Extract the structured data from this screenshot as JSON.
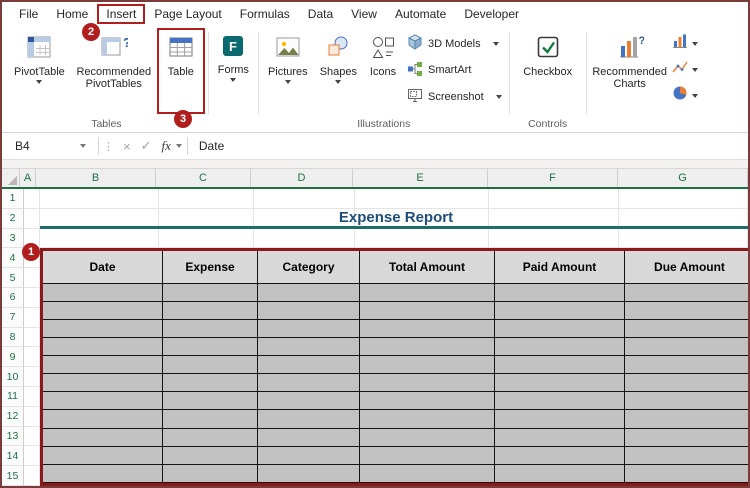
{
  "menu": {
    "tabs": [
      "File",
      "Home",
      "Insert",
      "Page Layout",
      "Formulas",
      "Data",
      "View",
      "Automate",
      "Developer"
    ],
    "active_tab": "Insert"
  },
  "ribbon": {
    "tables": {
      "label": "Tables",
      "pivottable": "PivotTable",
      "recommended_pivottables": "Recommended PivotTables",
      "table": "Table"
    },
    "forms": {
      "forms": "Forms"
    },
    "illustrations": {
      "label": "Illustrations",
      "pictures": "Pictures",
      "shapes": "Shapes",
      "icons": "Icons",
      "models_3d": "3D Models",
      "smartart": "SmartArt",
      "screenshot": "Screenshot"
    },
    "controls": {
      "label": "Controls",
      "checkbox": "Checkbox"
    },
    "charts": {
      "recommended_charts": "Recommended Charts"
    }
  },
  "formula_bar": {
    "name_box": "B4",
    "dots": "⋮",
    "cancel": "×",
    "enter": "✓",
    "fx": "fx",
    "formula": "Date"
  },
  "sheet": {
    "columns": [
      "A",
      "B",
      "C",
      "D",
      "E",
      "F",
      "G"
    ],
    "rows": [
      "1",
      "2",
      "3",
      "4",
      "5",
      "6",
      "7",
      "8",
      "9",
      "10",
      "11",
      "12",
      "13",
      "14",
      "15"
    ],
    "title": "Expense Report",
    "table": {
      "headers": [
        "Date",
        "Expense",
        "Category",
        "Total Amount",
        "Paid Amount",
        "Due Amount"
      ],
      "empty_rows": 11
    }
  },
  "annotations": {
    "steps": [
      "1",
      "2",
      "3"
    ]
  },
  "colors": {
    "annotation_red": "#b01e1e",
    "table_border_red": "#8a1a1a",
    "title_blue": "#1f4e79",
    "title_underline": "#1f6b6b",
    "header_green": "#1e7145",
    "cell_gray": "#c2c2c2",
    "header_cell_gray": "#d9d9d9"
  }
}
